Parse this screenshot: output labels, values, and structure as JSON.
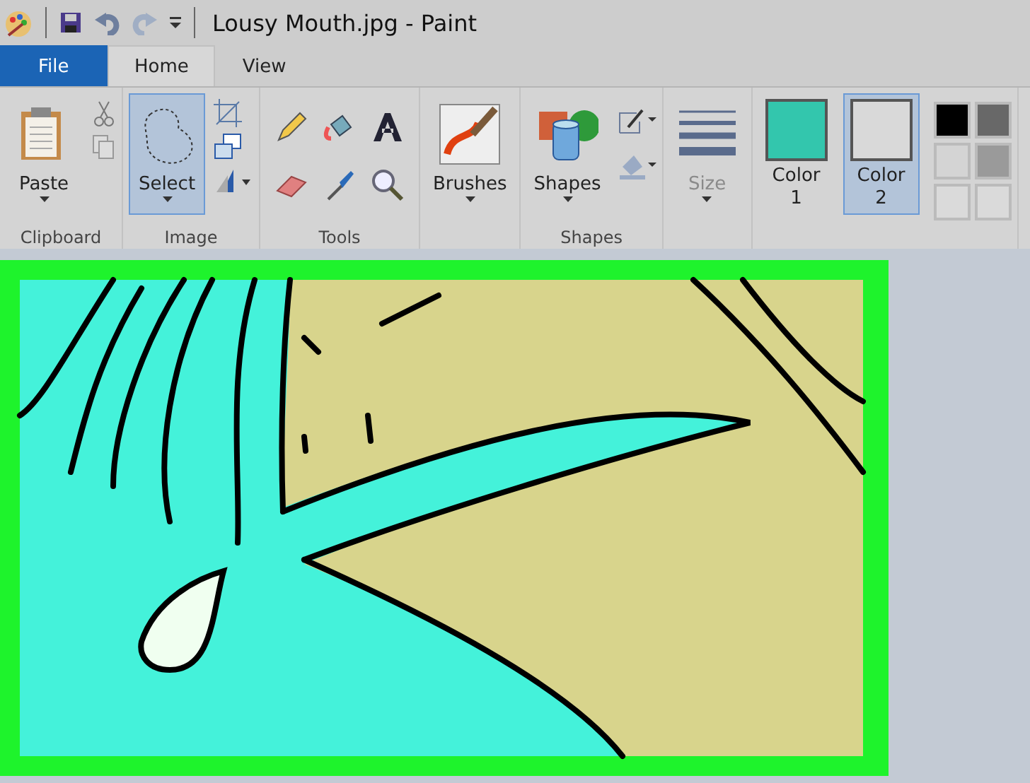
{
  "window": {
    "title": "Lousy Mouth.jpg - Paint"
  },
  "tabs": [
    {
      "label": "File",
      "kind": "file",
      "selected": false
    },
    {
      "label": "Home",
      "kind": "tab",
      "selected": true
    },
    {
      "label": "View",
      "kind": "tab",
      "selected": false
    }
  ],
  "ribbon": {
    "groups": [
      {
        "label": "Clipboard",
        "buttons": [
          {
            "label": "Paste",
            "kind": "paste",
            "selected": false,
            "disabled": false
          }
        ]
      },
      {
        "label": "Image",
        "buttons": [
          {
            "label": "Select",
            "kind": "select",
            "selected": true,
            "disabled": false
          }
        ]
      },
      {
        "label": "Tools"
      },
      {
        "buttons": [
          {
            "label": "Brushes",
            "kind": "brushes",
            "selected": false,
            "disabled": false
          }
        ]
      },
      {
        "label": "Shapes",
        "buttons": [
          {
            "label": "Shapes",
            "kind": "shapes",
            "selected": false,
            "disabled": false
          }
        ]
      },
      {
        "buttons": [
          {
            "label": "Size",
            "kind": "size",
            "selected": false,
            "disabled": true
          }
        ]
      },
      {
        "buttons": [
          {
            "label": "Color 1",
            "kind": "color",
            "color": "#33c6ad",
            "selected": false,
            "disabled": false
          },
          {
            "label": "Color 2",
            "kind": "color",
            "color": "#d9d9d9",
            "selected": true,
            "disabled": false
          }
        ]
      }
    ],
    "palette": [
      {
        "color": "#000000"
      },
      {
        "color": "#686868"
      },
      {
        "color": "#d4d4d4"
      },
      {
        "color": "#9a9a9a"
      },
      {
        "color": "#dadada"
      },
      {
        "color": "#dadada"
      }
    ]
  }
}
